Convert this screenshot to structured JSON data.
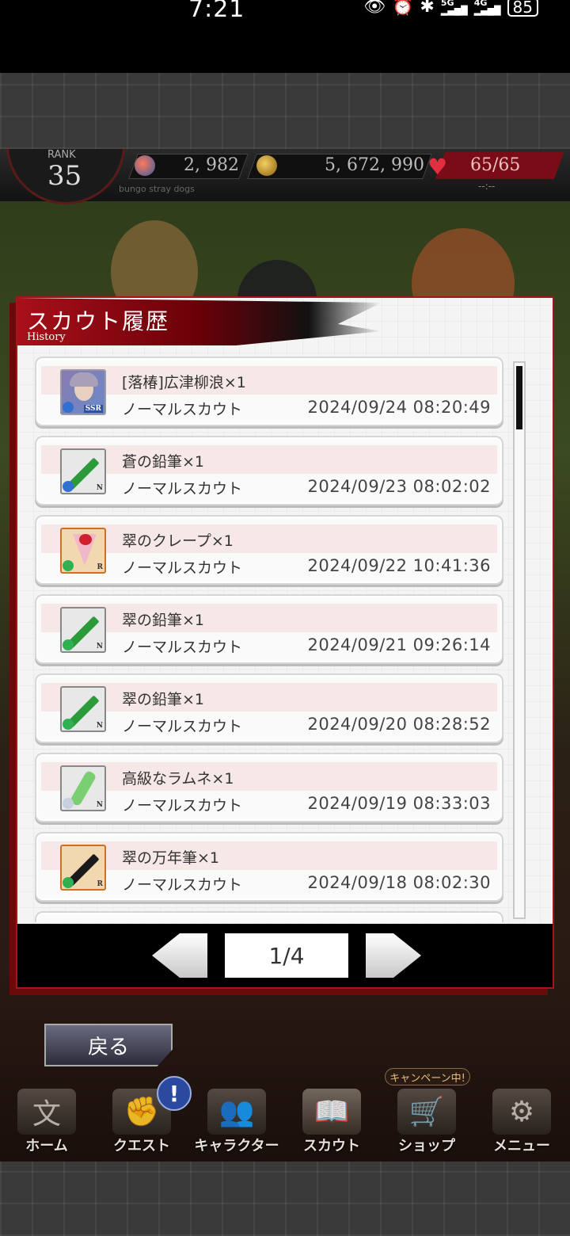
{
  "status_bar": {
    "time": "7:21",
    "icons": [
      "eye-icon",
      "alarm-icon",
      "bluetooth-icon",
      "signal-5g-icon",
      "signal-4g-icon"
    ],
    "battery": "85"
  },
  "hud": {
    "rank_label": "RANK",
    "rank_value": "35",
    "gems": "2, 982",
    "coins": "5, 672, 990",
    "stamina": "65/65",
    "stamina_timer": "--:--",
    "subtitle": "bungo stray dogs"
  },
  "panel": {
    "title": "スカウト履歴",
    "subtitle": "History"
  },
  "history": [
    {
      "name": "[落椿]広津柳浪×1",
      "type": "ノーマルスカウト",
      "date": "2024/09/24  08:20:49",
      "rarity": "SSR"
    },
    {
      "name": "蒼の鉛筆×1",
      "type": "ノーマルスカウト",
      "date": "2024/09/23  08:02:02",
      "rarity": "N"
    },
    {
      "name": "翠のクレープ×1",
      "type": "ノーマルスカウト",
      "date": "2024/09/22  10:41:36",
      "rarity": "R"
    },
    {
      "name": "翠の鉛筆×1",
      "type": "ノーマルスカウト",
      "date": "2024/09/21  09:26:14",
      "rarity": "N"
    },
    {
      "name": "翠の鉛筆×1",
      "type": "ノーマルスカウト",
      "date": "2024/09/20  08:28:52",
      "rarity": "N"
    },
    {
      "name": "高級なラムネ×1",
      "type": "ノーマルスカウト",
      "date": "2024/09/19  08:33:03",
      "rarity": "N"
    },
    {
      "name": "翠の万年筆×1",
      "type": "ノーマルスカウト",
      "date": "2024/09/18  08:02:30",
      "rarity": "R"
    }
  ],
  "pager": {
    "page": "1/4"
  },
  "back_button": "戻る",
  "nav": {
    "items": [
      {
        "label": "ホーム",
        "icon": "home-icon"
      },
      {
        "label": "クエスト",
        "icon": "quest-icon"
      },
      {
        "label": "キャラクター",
        "icon": "character-icon"
      },
      {
        "label": "スカウト",
        "icon": "scout-icon"
      },
      {
        "label": "ショップ",
        "icon": "shop-icon"
      },
      {
        "label": "メニュー",
        "icon": "menu-gear-icon"
      }
    ],
    "quest_badge": "!",
    "campaign_tag": "キャンペーン中!"
  },
  "colors": {
    "accent_red": "#a01818",
    "row_stripe": "#f6e8e6",
    "rarity_r": "#d07020"
  }
}
